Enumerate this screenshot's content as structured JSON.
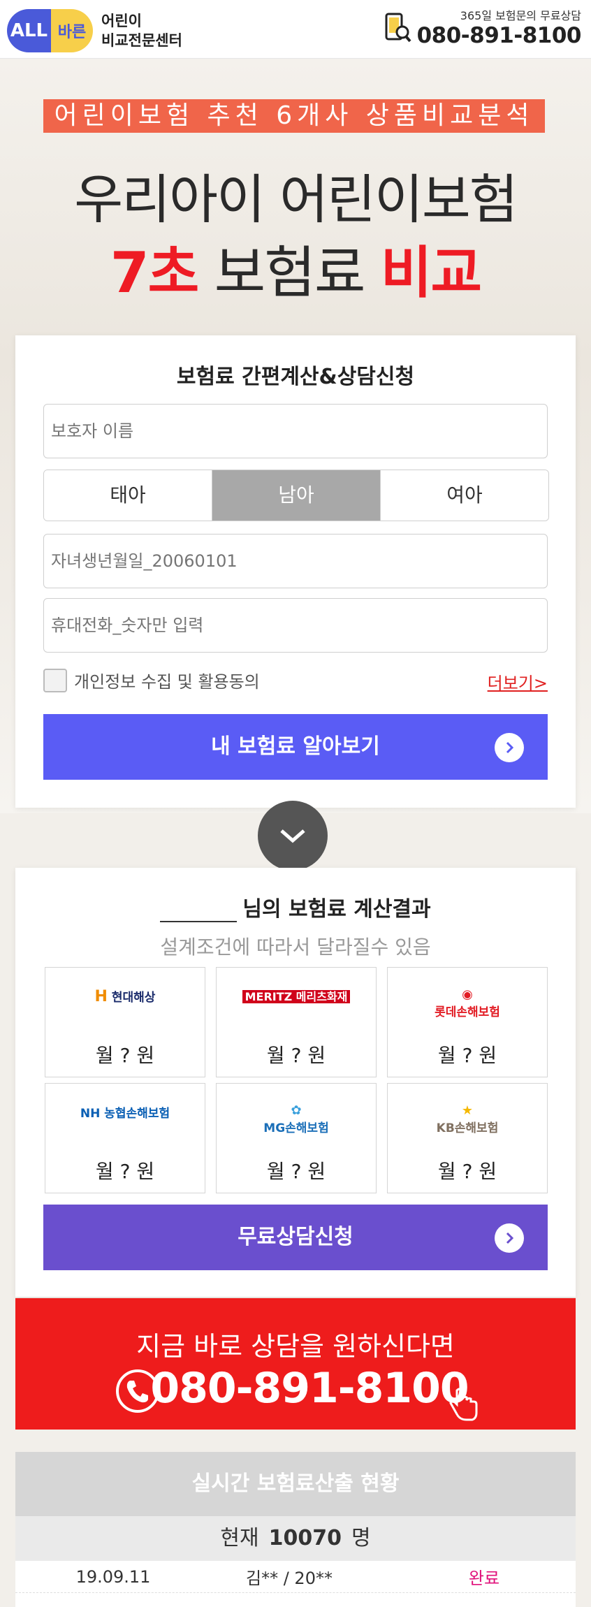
{
  "header": {
    "logo_all": "ALL",
    "logo_bareun": "바른",
    "brand_line1": "어린이",
    "brand_line2": "비교전문센터",
    "phone_sub": "365일 보험문의 무료상담",
    "phone_number": "080-891-8100"
  },
  "hero": {
    "band": "어린이보험 추천 6개사 상품비교분석",
    "title_line1": "우리아이 어린이보험",
    "title_line2_a": "7초",
    "title_line2_b": " 보험료 ",
    "title_line2_c": "비교"
  },
  "form": {
    "title": "보험료 간편계산&상담신청",
    "name_placeholder": "보호자 이름",
    "segments": [
      "태아",
      "남아",
      "여아"
    ],
    "active_segment": "남아",
    "birth_placeholder": "자녀생년월일_20060101",
    "phone_placeholder": "휴대전화_숫자만 입력",
    "agree_label": "개인정보 수집 및 활용동의",
    "more_link": "더보기>",
    "submit_label": "내 보험료 알아보기"
  },
  "result": {
    "title_suffix": "님의 보험료 계산결과",
    "subtitle": "설계조건에 따라서 달라질수 있음",
    "companies": [
      {
        "name": "현대해상",
        "color": "#f08c00",
        "icon": "hyundai-logo"
      },
      {
        "name": "MERITZ 메리츠화재",
        "color": "#d0021b",
        "icon": "meritz-logo"
      },
      {
        "name": "롯데손해보험",
        "color": "#e21b23",
        "icon": "lotte-logo"
      },
      {
        "name": "NH 농협손해보험",
        "color": "#0a5fb4",
        "icon": "nh-logo"
      },
      {
        "name": "MG손해보험",
        "color": "#1b6fb8",
        "icon": "mg-logo"
      },
      {
        "name": "KB손해보험",
        "color": "#807060",
        "icon": "kb-logo"
      }
    ],
    "price_text": "월 ? 원",
    "consult_label": "무료상담신청"
  },
  "call": {
    "subtitle": "지금 바로 상담을 원하신다면",
    "number": "080-891-8100"
  },
  "status": {
    "title": "실시간 보험료산출 현황",
    "count_prefix": "현재",
    "count": "10070",
    "count_suffix": "명",
    "rows": [
      {
        "date": "19.09.11",
        "name": "김** / 20**",
        "state": "완료"
      }
    ]
  }
}
